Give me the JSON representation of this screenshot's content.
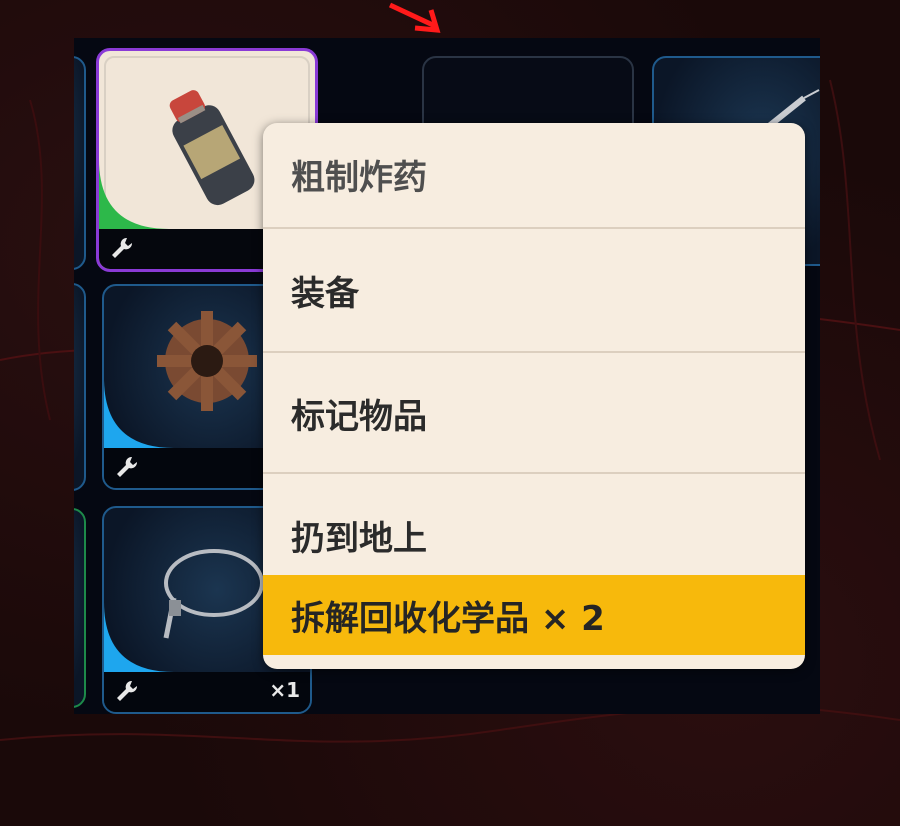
{
  "context_menu": {
    "title": "粗制炸药",
    "items": [
      {
        "label": "装备"
      },
      {
        "label": "标记物品"
      },
      {
        "label": "扔到地上"
      },
      {
        "label": "拆解回收化学品 × 2",
        "highlighted": true
      }
    ]
  },
  "inventory": {
    "slots": [
      {
        "icon": "explosive-bottle-icon",
        "rarity_color": "#2db84a",
        "frame_color": "#8a3ad6"
      },
      {
        "icon": "gear-icon",
        "rarity_color": "#1ea6ee"
      },
      {
        "icon": "wire-cable-icon",
        "rarity_color": "#1ea6ee",
        "count": "×1"
      },
      {
        "icon": "empty-slot-icon"
      },
      {
        "icon": "syringe-icon"
      }
    ]
  },
  "colors": {
    "menu_bg": "#f7ede0",
    "highlight": "#f7b90c",
    "uncommon": "#2db84a",
    "common": "#1ea6ee"
  }
}
